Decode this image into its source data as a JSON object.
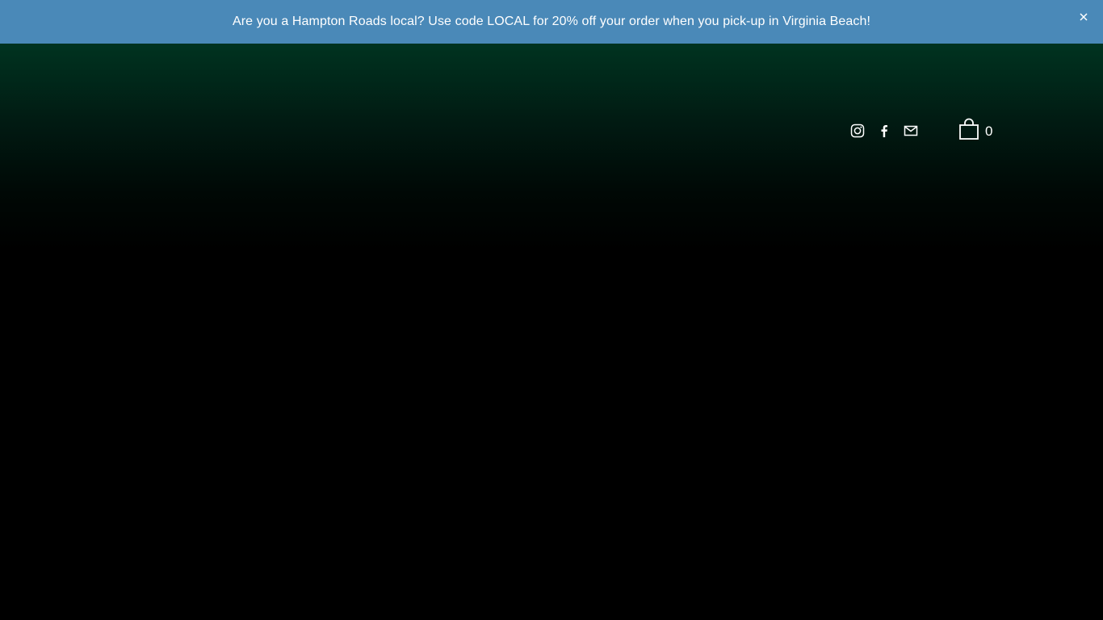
{
  "announcement": {
    "text": "Are you a Hampton Roads local? Use code LOCAL for 20% off your order when you pick-up in Virginia Beach!",
    "close_icon": "close-icon",
    "background": "#4a89b8"
  },
  "header": {
    "social": [
      {
        "icon": "instagram-icon"
      },
      {
        "icon": "facebook-icon"
      },
      {
        "icon": "email-icon"
      }
    ],
    "cart": {
      "icon": "shopping-bag-icon",
      "count": "0"
    }
  },
  "colors": {
    "hero_top": "#003320",
    "hero_bottom": "#000000",
    "icon": "#ffffff"
  }
}
